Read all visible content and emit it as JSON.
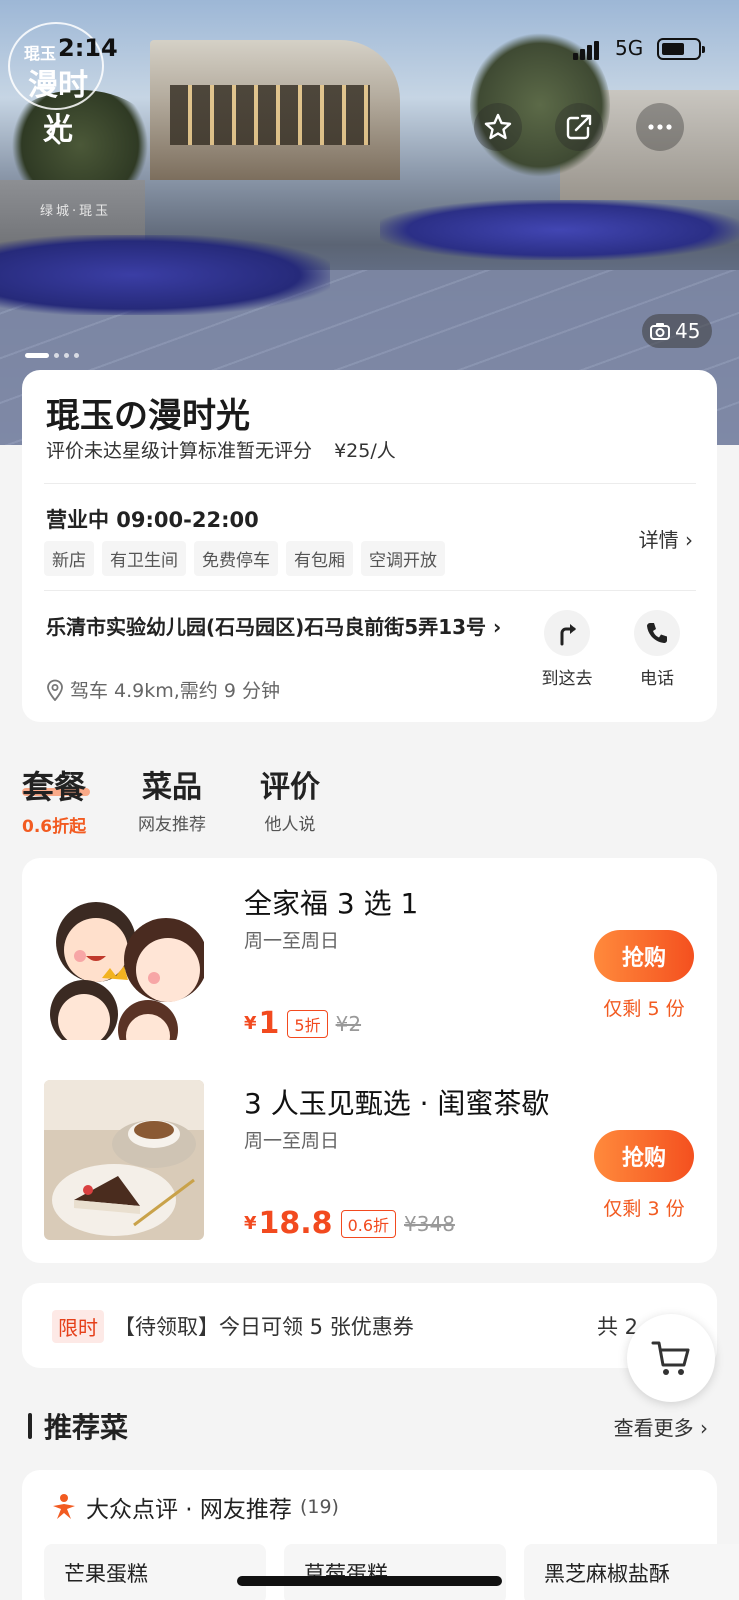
{
  "status_bar": {
    "time": "2:14",
    "network": "5G"
  },
  "hero": {
    "logo_line1": "琨玉",
    "logo_line2": "漫时光",
    "wall_sign": "绿城·琨玉",
    "photo_count": "45"
  },
  "shop": {
    "name": "琨玉の漫时光",
    "rating_text": "评价未达星级计算标准暂无评分",
    "price": "¥25/人",
    "hours": "营业中 09:00-22:00",
    "tags": [
      "新店",
      "有卫生间",
      "免费停车",
      "有包厢",
      "空调开放"
    ],
    "detail_label": "详情",
    "address": "乐清市实验幼儿园(石马园区)石马良前街5弄13号",
    "drive_info": "驾车 4.9km,需约 9 分钟",
    "action_go": "到这去",
    "action_call": "电话"
  },
  "tabs": [
    {
      "title": "套餐",
      "sub": "0.6折起"
    },
    {
      "title": "菜品",
      "sub": "网友推荐"
    },
    {
      "title": "评价",
      "sub": "他人说"
    }
  ],
  "deals": [
    {
      "title": "全家福 3 选 1",
      "days": "周一至周日",
      "yen": "¥",
      "price": "1",
      "discount": "5折",
      "original": "¥2",
      "buy_label": "抢购",
      "remaining": "仅剩 5 份"
    },
    {
      "title": "3 人玉见甄选 · 闺蜜茶歇",
      "days": "周一至周日",
      "yen": "¥",
      "price": "18.8",
      "discount": "0.6折",
      "original": "¥348",
      "buy_label": "抢购",
      "remaining": "仅剩 3 份"
    }
  ],
  "coupon": {
    "limit_label": "限时",
    "text": "【待领取】今日可领 5 张优惠券",
    "total": "共 2"
  },
  "recommend": {
    "title": "推荐菜",
    "more": "查看更多",
    "source": "大众点评 · 网友推荐",
    "count": "(19)",
    "dishes": [
      "芒果蛋糕",
      "草莓蛋糕",
      "黑芝麻椒盐酥"
    ]
  },
  "colors": {
    "accent": "#f24a1f",
    "buy_gradient_start": "#ff8a3c"
  }
}
